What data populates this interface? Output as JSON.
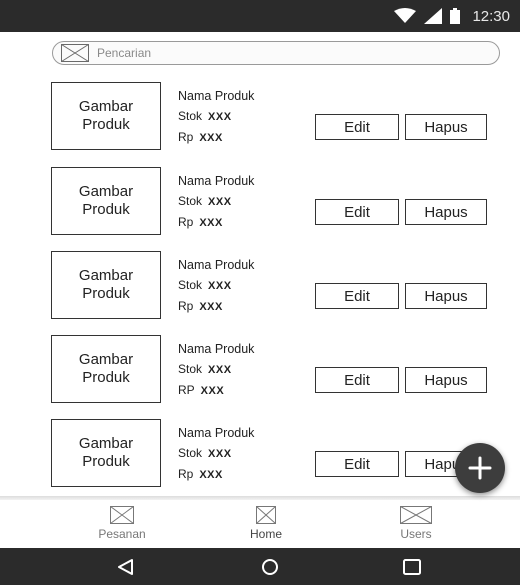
{
  "status_bar": {
    "time": "12:30"
  },
  "search": {
    "placeholder": "Pencarian"
  },
  "products": [
    {
      "image_label": "Gambar Produk",
      "name": "Nama Produk",
      "stock_label": "Stok",
      "stock_value": "XXX",
      "price_label": "Rp",
      "price_value": "XXX",
      "edit_label": "Edit",
      "delete_label": "Hapus"
    },
    {
      "image_label": "Gambar Produk",
      "name": "Nama Produk",
      "stock_label": "Stok",
      "stock_value": "XXX",
      "price_label": "Rp",
      "price_value": "XXX",
      "edit_label": "Edit",
      "delete_label": "Hapus"
    },
    {
      "image_label": "Gambar Produk",
      "name": "Nama Produk",
      "stock_label": "Stok",
      "stock_value": "XXX",
      "price_label": "Rp",
      "price_value": "XXX",
      "edit_label": "Edit",
      "delete_label": "Hapus"
    },
    {
      "image_label": "Gambar Produk",
      "name": "Nama Produk",
      "stock_label": "Stok",
      "stock_value": "XXX",
      "price_label": "RP",
      "price_value": "XXX",
      "edit_label": "Edit",
      "delete_label": "Hapus"
    },
    {
      "image_label": "Gambar Produk",
      "name": "Nama Produk",
      "stock_label": "Stok",
      "stock_value": "XXX",
      "price_label": "Rp",
      "price_value": "XXX",
      "edit_label": "Edit",
      "delete_label": "Hapus"
    }
  ],
  "fab": {
    "icon": "plus-icon"
  },
  "bottom_nav": {
    "items": [
      {
        "label": "Pesanan",
        "icon": "placeholder-image-icon"
      },
      {
        "label": "Home",
        "icon": "placeholder-image-icon"
      },
      {
        "label": "Users",
        "icon": "placeholder-image-icon"
      }
    ]
  },
  "system_nav": {
    "icons": [
      "back-triangle-icon",
      "home-circle-icon",
      "recents-square-icon"
    ]
  },
  "colors": {
    "bar_dark": "#2b2b2b",
    "fab": "#3d3d3d",
    "border": "#333333"
  }
}
